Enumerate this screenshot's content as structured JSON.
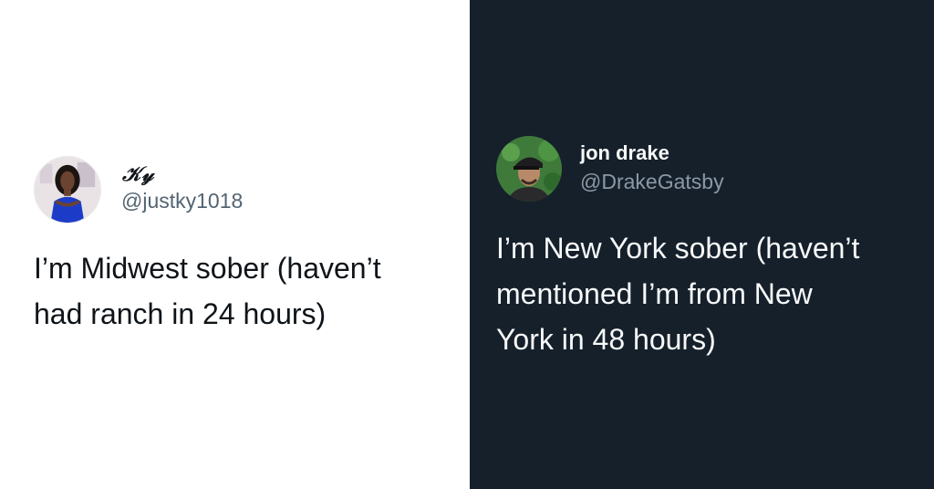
{
  "left_tweet": {
    "display_name": "𝒦𝓎",
    "handle": "@justky1018",
    "text_lines": [
      "I’m Midwest sober (haven’t",
      "had ranch in 24 hours)"
    ],
    "avatar_icon": "profile-photo-woman-blue-dress"
  },
  "right_tweet": {
    "display_name": "jon drake",
    "handle": "@DrakeGatsby",
    "text_lines": [
      "I’m New York sober (haven’t",
      "mentioned I’m from New",
      "York in 48 hours)"
    ],
    "avatar_icon": "profile-photo-man-cap"
  },
  "colors": {
    "light_bg": "#ffffff",
    "dark_bg": "#15202b",
    "light_handle": "#536471",
    "dark_handle": "#8b98a5"
  }
}
